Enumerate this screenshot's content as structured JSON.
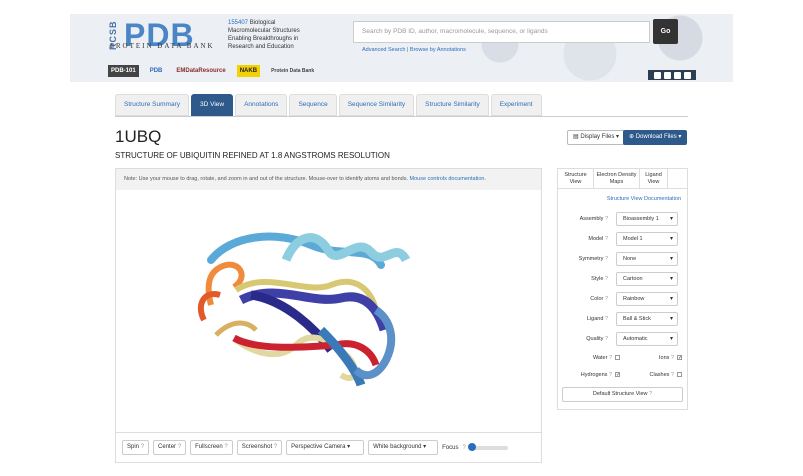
{
  "header": {
    "logo_side": "RCSB",
    "logo_main": "PDB",
    "logo_sub": "PROTEIN DATA BANK",
    "tagline_count": "155407",
    "tagline_text": " Biological Macromolecular Structures Enabling Breakthroughs in Research and Education",
    "search_placeholder": "Search by PDB ID, author, macromolecule, sequence, or ligands",
    "go_label": "Go",
    "advanced_search": "Advanced Search",
    "browse_annotations": "Browse by Annotations",
    "partners": [
      "PDB-101",
      "PDB",
      "EMDataResource",
      "NAKB",
      "Protein Data Bank"
    ]
  },
  "tabs": [
    "Structure Summary",
    "3D View",
    "Annotations",
    "Sequence",
    "Sequence Similarity",
    "Structure Similarity",
    "Experiment"
  ],
  "entry": {
    "id": "1UBQ",
    "title": "STRUCTURE OF UBIQUITIN REFINED AT 1.8 ANGSTROMS RESOLUTION",
    "display_files": "Display Files",
    "download_files": "Download Files"
  },
  "viewer": {
    "note": "Note: Use your mouse to drag, rotate, and zoom in and out of the structure. Mouse-over to identify atoms and bonds.",
    "note_link": "Mouse controls documentation.",
    "controls": {
      "spin": "Spin",
      "center": "Center",
      "fullscreen": "Fullscreen",
      "screenshot": "Screenshot",
      "camera": "Perspective Camera",
      "background": "White background",
      "focus": "Focus"
    }
  },
  "side": {
    "tabs": [
      "Structure View",
      "Electron Density Maps",
      "Ligand View"
    ],
    "doc_link": "Structure View Documentation",
    "rows": [
      {
        "label": "Assembly",
        "value": "Bioassembly 1"
      },
      {
        "label": "Model",
        "value": "Model 1"
      },
      {
        "label": "Symmetry",
        "value": "None"
      },
      {
        "label": "Style",
        "value": "Cartoon"
      },
      {
        "label": "Color",
        "value": "Rainbow"
      },
      {
        "label": "Ligand",
        "value": "Ball & Stick"
      },
      {
        "label": "Quality",
        "value": "Automatic"
      }
    ],
    "water": "Water",
    "ions": "Ions",
    "hydrogens": "Hydrogens",
    "clashes": "Clashes",
    "default_view": "Default Structure View"
  }
}
